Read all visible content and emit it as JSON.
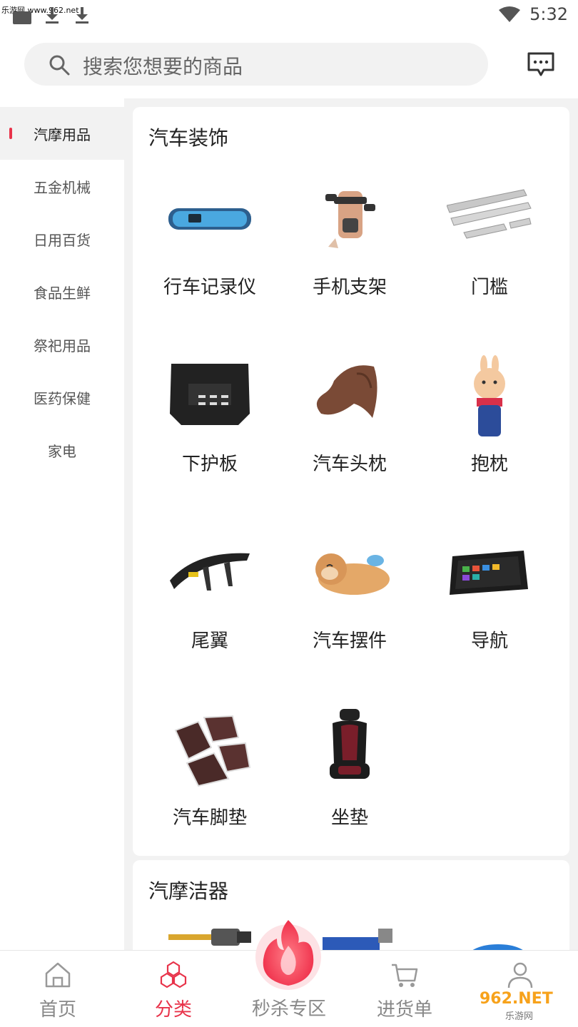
{
  "status_bar": {
    "watermark": "乐游网 www.962.net",
    "time": "5:32"
  },
  "search": {
    "placeholder": "搜索您想要的商品"
  },
  "sidebar": {
    "items": [
      {
        "label": "汽摩用品",
        "active": true
      },
      {
        "label": "五金机械",
        "active": false
      },
      {
        "label": "日用百货",
        "active": false
      },
      {
        "label": "食品生鲜",
        "active": false
      },
      {
        "label": "祭祀用品",
        "active": false
      },
      {
        "label": "医药保健",
        "active": false
      },
      {
        "label": "家电",
        "active": false
      }
    ]
  },
  "sections": [
    {
      "title": "汽车装饰",
      "items": [
        {
          "label": "行车记录仪",
          "icon": "dash-cam-mirror"
        },
        {
          "label": "手机支架",
          "icon": "phone-holder"
        },
        {
          "label": "门槛",
          "icon": "door-sill-strips"
        },
        {
          "label": "下护板",
          "icon": "engine-skid-plate"
        },
        {
          "label": "汽车头枕",
          "icon": "headrest-pillow"
        },
        {
          "label": "抱枕",
          "icon": "bunny-pillow"
        },
        {
          "label": "尾翼",
          "icon": "rear-spoiler"
        },
        {
          "label": "汽车摆件",
          "icon": "sleeping-bear-ornament"
        },
        {
          "label": "导航",
          "icon": "navigation-device"
        },
        {
          "label": "汽车脚垫",
          "icon": "car-floor-mats"
        },
        {
          "label": "坐垫",
          "icon": "seat-cushion"
        }
      ]
    },
    {
      "title": "汽摩洁器",
      "items": []
    }
  ],
  "bottom_nav": {
    "items": [
      {
        "label": "首页",
        "icon": "home-icon",
        "active": false
      },
      {
        "label": "分类",
        "icon": "category-icon",
        "active": true
      },
      {
        "label": "秒杀专区",
        "icon": "flame-icon",
        "active": false
      },
      {
        "label": "进货单",
        "icon": "cart-icon",
        "active": false
      },
      {
        "label": "",
        "icon": "user-icon",
        "active": false
      }
    ]
  },
  "watermark_logo": {
    "text": "962.NET",
    "sub": "乐游网"
  },
  "colors": {
    "accent": "#e8334a",
    "background": "#f2f2f2"
  }
}
